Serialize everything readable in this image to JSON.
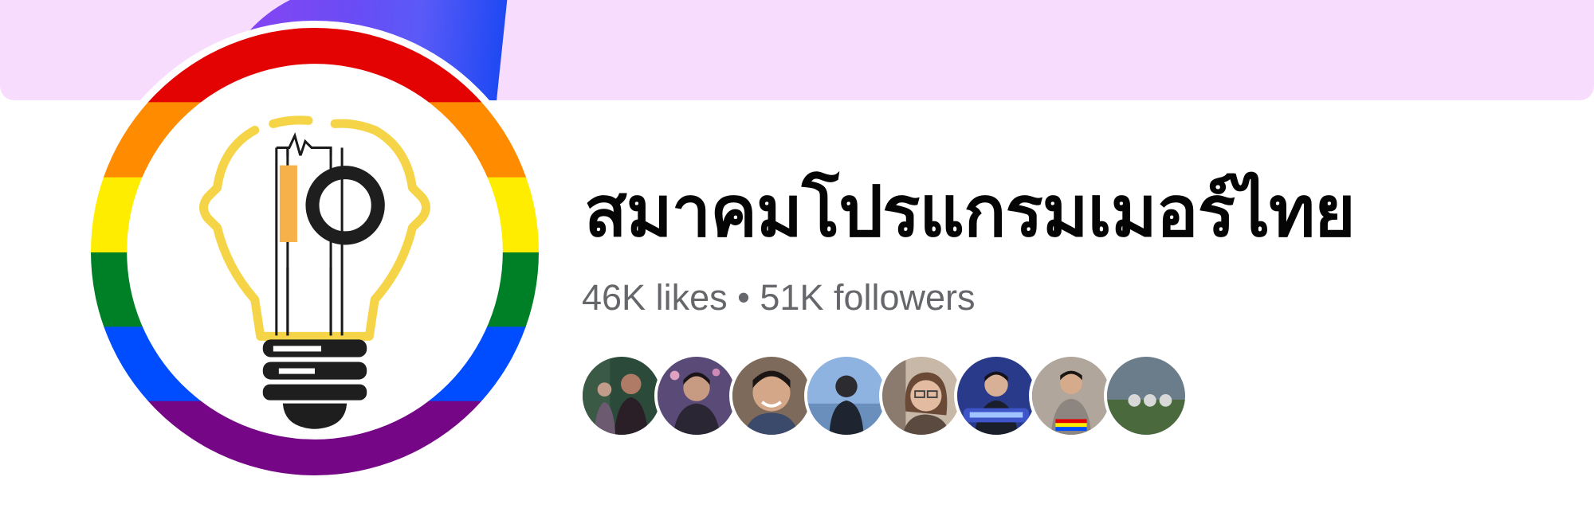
{
  "page": {
    "title": "สมาคมโปรแกรมเมอร์ไทย",
    "likes": "46K likes",
    "separator": "•",
    "followers": "51K followers"
  },
  "cover": {
    "background_color": "#f8dcfd",
    "accent_color": "#6a4cf5"
  },
  "avatar": {
    "icon": "rainbow-lightbulb-io-logo",
    "ring_colors": [
      "#e40303",
      "#ff8c00",
      "#ffed00",
      "#008026",
      "#004dff",
      "#750787"
    ]
  },
  "follower_avatars": [
    {
      "name": "follower-avatar-1",
      "color": "#3d2e37"
    },
    {
      "name": "follower-avatar-2",
      "color": "#6e5a80"
    },
    {
      "name": "follower-avatar-3",
      "color": "#8a6a55"
    },
    {
      "name": "follower-avatar-4",
      "color": "#4b6fa8"
    },
    {
      "name": "follower-avatar-5",
      "color": "#a38c7a"
    },
    {
      "name": "follower-avatar-6",
      "color": "#3a4a9a"
    },
    {
      "name": "follower-avatar-7",
      "color": "#b8aea4"
    },
    {
      "name": "follower-avatar-8",
      "color": "#5e7a52"
    }
  ]
}
